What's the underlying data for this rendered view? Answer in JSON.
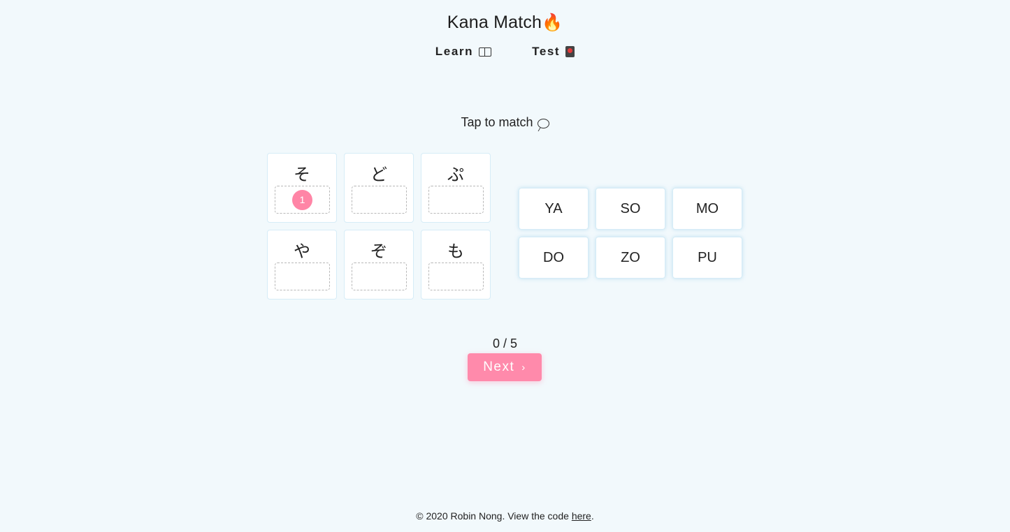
{
  "header": {
    "title": "Kana Match",
    "title_emoji": "🔥"
  },
  "nav": {
    "learn_label": "Learn",
    "learn_icon": "open-book-icon",
    "test_label": "Test",
    "test_icon": "flower-playing-card-icon"
  },
  "instruction": {
    "text": "Tap to match",
    "icon": "speech-bubble-icon"
  },
  "kana_cards": [
    {
      "kana": "そ",
      "slot_badge": "1"
    },
    {
      "kana": "ど",
      "slot_badge": ""
    },
    {
      "kana": "ぷ",
      "slot_badge": ""
    },
    {
      "kana": "や",
      "slot_badge": ""
    },
    {
      "kana": "ぞ",
      "slot_badge": ""
    },
    {
      "kana": "も",
      "slot_badge": ""
    }
  ],
  "romaji_cards": [
    "YA",
    "SO",
    "MO",
    "DO",
    "ZO",
    "PU"
  ],
  "progress": {
    "text": "0 / 5"
  },
  "next_button": {
    "label": "Next",
    "icon": "chevron-right-icon",
    "icon_glyph": "›"
  },
  "footer": {
    "text": "© 2020 Robin Nong. View the code ",
    "link_label": "here",
    "suffix": "."
  },
  "colors": {
    "background": "#f2f9fc",
    "accent_pink": "#ff85a6",
    "card_border": "#d6ecf7"
  }
}
